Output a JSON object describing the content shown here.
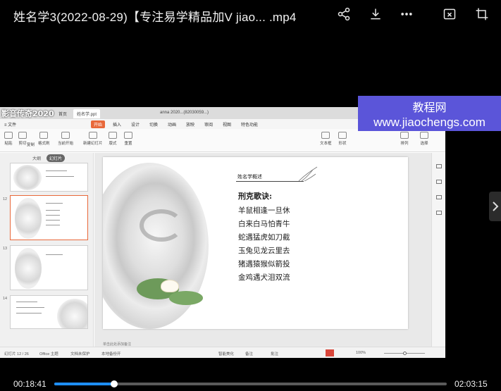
{
  "header": {
    "title": "姓名学3(2022-08-29)【专注易学精品加V jiao...  .mp4",
    "share_icon": "share-icon",
    "download_icon": "download-icon",
    "more_icon": "more-icon",
    "pip_icon": "picture-in-picture-icon",
    "crop_icon": "crop-icon"
  },
  "watermark": {
    "line1": "教程网",
    "line2": "www.jiaochengs.com"
  },
  "video": {
    "app_logo": "影音传奇2020",
    "tabs": [
      "首页",
      "姓名学.ppt",
      "anna 2020...(82030059...)"
    ],
    "menu": [
      "≡ 文件",
      "开始",
      "插入",
      "设计",
      "切换",
      "动画",
      "放映",
      "审阅",
      "视图",
      "特色功能"
    ],
    "ribbon": [
      "粘贴",
      "剪切",
      "复制",
      "格式刷",
      "当前开始",
      "新建幻灯片",
      "版式",
      "重置",
      "文本框",
      "形状",
      "排列",
      "选择"
    ],
    "thumbs_header": [
      "大纲",
      "幻灯片"
    ],
    "slide_numbers": [
      "12",
      "13",
      "14"
    ],
    "slide": {
      "title": "姓名学概述",
      "poem_head": "刑克歌诀:",
      "poem_lines": [
        "羊鼠相逢一旦休",
        "白来白马怕青牛",
        "蛇遇猛虎如刀截",
        "玉兔见龙云里去",
        "猪遇猿猴似箭投",
        "金鸡遇犬泪双流"
      ]
    },
    "notes": "单击此处添加备注",
    "status": {
      "slide_count": "幻灯片 12 / 26",
      "theme": "Office 主题",
      "doc_state": "文档未保护",
      "backup": "本地备份开",
      "beautify": "智能美化",
      "notes_btn": "备注",
      "comments": "批注",
      "zoom": "100%"
    }
  },
  "player": {
    "current_time": "00:18:41",
    "duration": "02:03:15",
    "progress": 0.152
  }
}
